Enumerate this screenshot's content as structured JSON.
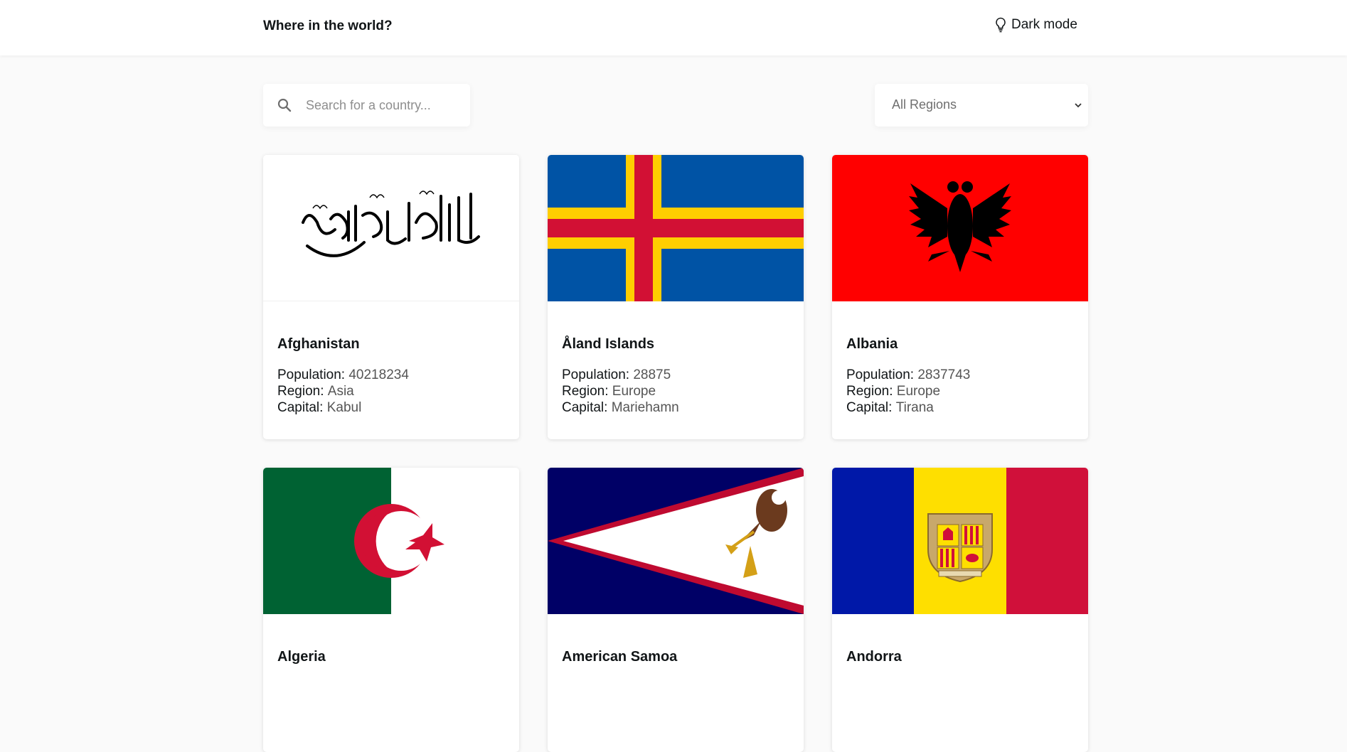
{
  "header": {
    "title": "Where in the world?",
    "dark_mode_label": "Dark mode"
  },
  "search": {
    "placeholder": "Search for a country...",
    "value": ""
  },
  "filter": {
    "selected": "All Regions"
  },
  "labels": {
    "population": "Population:",
    "region": "Region:",
    "capital": "Capital:"
  },
  "countries": [
    {
      "name": "Afghanistan",
      "population": "40218234",
      "region": "Asia",
      "capital": "Kabul"
    },
    {
      "name": "Åland Islands",
      "population": "28875",
      "region": "Europe",
      "capital": "Mariehamn"
    },
    {
      "name": "Albania",
      "population": "2837743",
      "region": "Europe",
      "capital": "Tirana"
    },
    {
      "name": "Algeria",
      "population": "",
      "region": "",
      "capital": ""
    },
    {
      "name": "American Samoa",
      "population": "",
      "region": "",
      "capital": ""
    },
    {
      "name": "Andorra",
      "population": "",
      "region": "",
      "capital": ""
    }
  ],
  "colors": {
    "background": "#fafafa",
    "surface": "#ffffff",
    "text": "#111517"
  }
}
